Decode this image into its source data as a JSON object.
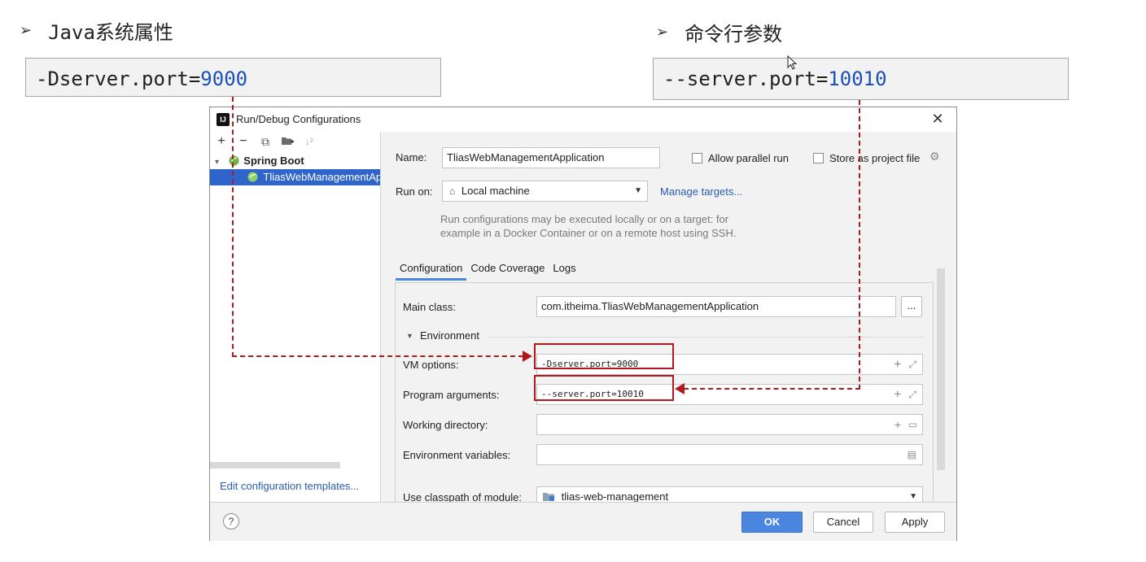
{
  "slide": {
    "left_heading": "Java系统属性",
    "right_heading": "命令行参数",
    "left_code_key": "-Dserver.port=",
    "left_code_value": "9000",
    "right_code_key": "--server.port=",
    "right_code_value": "10010"
  },
  "dialog": {
    "title": "Run/Debug Configurations",
    "tree": {
      "group": "Spring Boot",
      "item": "TliasWebManagementApplication"
    },
    "edit_templates_link": "Edit configuration templates...",
    "name_label": "Name:",
    "name_value": "TliasWebManagementApplication",
    "allow_parallel_label": "Allow parallel run",
    "store_project_label": "Store as project file",
    "run_on_label": "Run on:",
    "run_on_value": "Local machine",
    "manage_targets_link": "Manage targets...",
    "run_hint_line1": "Run configurations may be executed locally or on a target: for",
    "run_hint_line2": "example in a Docker Container or on a remote host using SSH.",
    "tabs": [
      "Configuration",
      "Code Coverage",
      "Logs"
    ],
    "main_class_label": "Main class:",
    "main_class_value": "com.itheima.TliasWebManagementApplication",
    "browse_label": "...",
    "environment_label": "Environment",
    "vm_options_label": "VM options:",
    "vm_options_value": "-Dserver.port=9000",
    "program_args_label": "Program arguments:",
    "program_args_value": "--server.port=10010",
    "working_dir_label": "Working directory:",
    "env_vars_label": "Environment variables:",
    "classpath_label": "Use classpath of module:",
    "classpath_value": "tlias-web-management",
    "buttons": {
      "ok": "OK",
      "cancel": "Cancel",
      "apply": "Apply"
    },
    "help_label": "?"
  },
  "colors": {
    "accent": "#4a86e0",
    "selection": "#2f65ca",
    "highlight_red": "#b2191c",
    "code_value_blue": "#1d4fb8"
  }
}
